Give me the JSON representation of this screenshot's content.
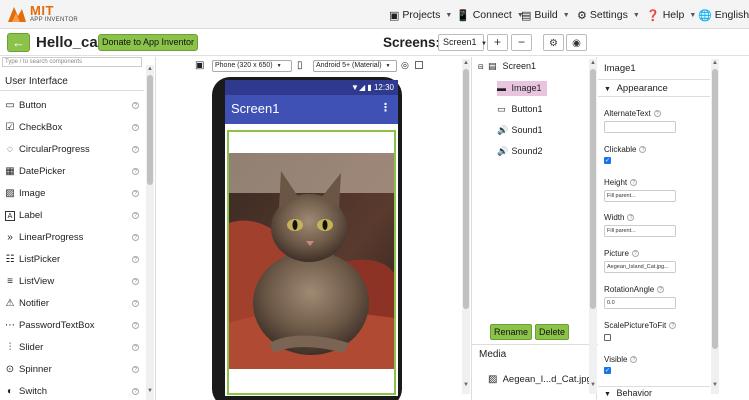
{
  "app": {
    "logo_top": "MIT",
    "logo_bottom": "APP INVENTOR"
  },
  "topmenu": [
    {
      "icon": "folder-icon",
      "label": "Projects"
    },
    {
      "icon": "connect-icon",
      "label": "Connect"
    },
    {
      "icon": "build-icon",
      "label": "Build"
    },
    {
      "icon": "gear-icon",
      "label": "Settings"
    },
    {
      "icon": "help-icon",
      "label": "Help"
    },
    {
      "icon": "globe-icon",
      "label": "English"
    }
  ],
  "project": {
    "back_glyph": "←",
    "name": "Hello_cat",
    "donate_label": "Donate to App Inventor",
    "screens_label": "Screens:",
    "current_screen": "Screen1",
    "add_glyph": "+",
    "remove_glyph": "−"
  },
  "palette": {
    "search_placeholder": "Type / to search components",
    "category": "User Interface",
    "items": [
      {
        "icon": "button-icon",
        "glyph": "▭",
        "label": "Button"
      },
      {
        "icon": "checkbox-icon",
        "glyph": "☑",
        "label": "CheckBox"
      },
      {
        "icon": "circular-progress-icon",
        "glyph": "◌",
        "label": "CircularProgress"
      },
      {
        "icon": "datepicker-icon",
        "glyph": "▦",
        "label": "DatePicker"
      },
      {
        "icon": "image-icon",
        "glyph": "▨",
        "label": "Image"
      },
      {
        "icon": "label-icon",
        "glyph": "A",
        "label": "Label"
      },
      {
        "icon": "linear-progress-icon",
        "glyph": "»",
        "label": "LinearProgress"
      },
      {
        "icon": "listpicker-icon",
        "glyph": "☷",
        "label": "ListPicker"
      },
      {
        "icon": "listview-icon",
        "glyph": "≡",
        "label": "ListView"
      },
      {
        "icon": "notifier-icon",
        "glyph": "⚠",
        "label": "Notifier"
      },
      {
        "icon": "password-icon",
        "glyph": "⋯",
        "label": "PasswordTextBox"
      },
      {
        "icon": "slider-icon",
        "glyph": "⫶",
        "label": "Slider"
      },
      {
        "icon": "spinner-icon",
        "glyph": "⊙",
        "label": "Spinner"
      },
      {
        "icon": "switch-icon",
        "glyph": "◐",
        "label": "Switch"
      }
    ]
  },
  "viewer": {
    "device": "Phone (320 x 650)",
    "theme": "Android 5+ (Material)",
    "status_time": "12:30",
    "screen_title": "Screen1",
    "menu_glyph": "⋮"
  },
  "components": {
    "tree": [
      {
        "icon": "screen-icon",
        "glyph": "▤",
        "label": "Screen1"
      },
      {
        "icon": "image-icon",
        "glyph": "▬",
        "label": "Image1"
      },
      {
        "icon": "button-icon",
        "glyph": "▭",
        "label": "Button1"
      },
      {
        "icon": "sound-icon",
        "glyph": "🔊",
        "label": "Sound1"
      },
      {
        "icon": "sound-icon",
        "glyph": "🔊",
        "label": "Sound2"
      }
    ],
    "rename_label": "Rename",
    "delete_label": "Delete",
    "media_title": "Media",
    "media_file": "Aegean_I...d_Cat.jpg"
  },
  "properties": {
    "component": "Image1",
    "section": "Appearance",
    "alternate_text_label": "AlternateText",
    "alternate_text_value": "",
    "clickable_label": "Clickable",
    "clickable": true,
    "height_label": "Height",
    "height_value": "Fill parent...",
    "width_label": "Width",
    "width_value": "Fill parent...",
    "picture_label": "Picture",
    "picture_value": "Aegean_Island_Cat.jpg...",
    "rotation_label": "RotationAngle",
    "rotation_value": "0.0",
    "scale_label": "ScalePictureToFit",
    "scale": false,
    "visible_label": "Visible",
    "visible": true,
    "behavior_section": "Behavior"
  }
}
